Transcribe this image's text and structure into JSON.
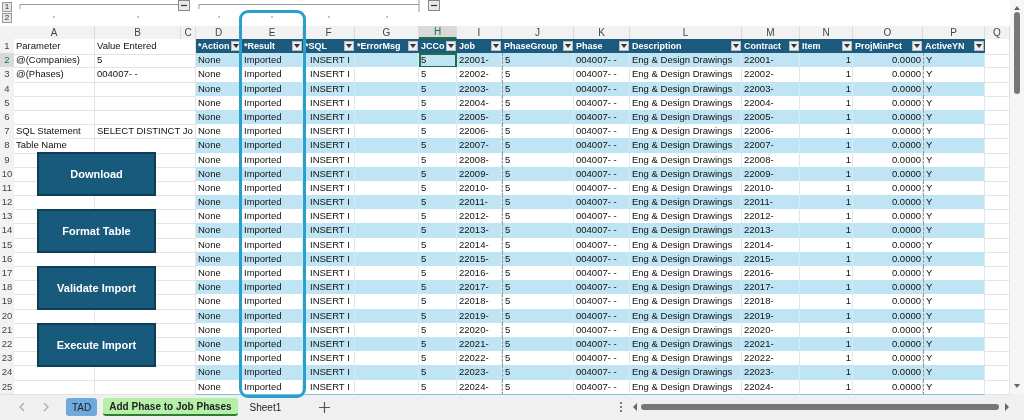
{
  "outline": {
    "levels": [
      "1",
      "2"
    ]
  },
  "columns": [
    {
      "letter": "A",
      "selected": false
    },
    {
      "letter": "B",
      "selected": false
    },
    {
      "letter": "C",
      "selected": false
    },
    {
      "letter": "D",
      "selected": false
    },
    {
      "letter": "E",
      "selected": false
    },
    {
      "letter": "F",
      "selected": false
    },
    {
      "letter": "G",
      "selected": false
    },
    {
      "letter": "H",
      "selected": true
    },
    {
      "letter": "I",
      "selected": false
    },
    {
      "letter": "J",
      "selected": false
    },
    {
      "letter": "K",
      "selected": false
    },
    {
      "letter": "L",
      "selected": false
    },
    {
      "letter": "M",
      "selected": false
    },
    {
      "letter": "N",
      "selected": false
    },
    {
      "letter": "O",
      "selected": false
    },
    {
      "letter": "P",
      "selected": false
    },
    {
      "letter": "Q",
      "selected": false
    }
  ],
  "sheet_rows": [
    {
      "number": "1",
      "selected": false,
      "A": "Parameter",
      "B": "Value Entered"
    },
    {
      "number": "2",
      "selected": true,
      "A": "@(Companies)",
      "B": "5"
    },
    {
      "number": "3",
      "selected": false,
      "A": "@(Phases)",
      "B": "004007-  -"
    },
    {
      "number": "4",
      "selected": false
    },
    {
      "number": "5",
      "selected": false
    },
    {
      "number": "6",
      "selected": false
    },
    {
      "number": "7",
      "selected": false,
      "A": "SQL Statement",
      "B": "SELECT DISTINCT Jo"
    },
    {
      "number": "8",
      "selected": false,
      "A": "Table Name"
    },
    {
      "number": "9",
      "selected": false
    },
    {
      "number": "10",
      "selected": false
    },
    {
      "number": "11",
      "selected": false
    },
    {
      "number": "12",
      "selected": false
    },
    {
      "number": "13",
      "selected": false
    },
    {
      "number": "14",
      "selected": false
    },
    {
      "number": "15",
      "selected": false
    },
    {
      "number": "16",
      "selected": false
    },
    {
      "number": "17",
      "selected": false
    },
    {
      "number": "18",
      "selected": false
    },
    {
      "number": "19",
      "selected": false
    },
    {
      "number": "20",
      "selected": false
    },
    {
      "number": "21",
      "selected": false
    },
    {
      "number": "22",
      "selected": false
    },
    {
      "number": "23",
      "selected": false
    },
    {
      "number": "24",
      "selected": false
    },
    {
      "number": "25",
      "selected": false
    }
  ],
  "table": {
    "headers": [
      {
        "label": "*Action"
      },
      {
        "label": "*Result"
      },
      {
        "label": "*SQL"
      },
      {
        "label": "*ErrorMsg"
      },
      {
        "label": "JCCo"
      },
      {
        "label": "Job"
      },
      {
        "label": "PhaseGroup"
      },
      {
        "label": "Phase"
      },
      {
        "label": "Description"
      },
      {
        "label": "Contract"
      },
      {
        "label": "Item"
      },
      {
        "label": "ProjMinPct"
      },
      {
        "label": "ActiveYN"
      }
    ],
    "rows": [
      {
        "D": "None",
        "E": "Imported",
        "F": "INSERT I",
        "H": "5",
        "I": "22001-",
        "J": "5",
        "K": "004007-  -",
        "L": "Eng & Design Drawings",
        "M": "22001-",
        "N": "1",
        "O": "0.0000",
        "P": "Y"
      },
      {
        "D": "None",
        "E": "Imported",
        "F": "INSERT I",
        "H": "5",
        "I": "22002-",
        "J": "5",
        "K": "004007-  -",
        "L": "Eng & Design Drawings",
        "M": "22002-",
        "N": "1",
        "O": "0.0000",
        "P": "Y"
      },
      {
        "D": "None",
        "E": "Imported",
        "F": "INSERT I",
        "H": "5",
        "I": "22003-",
        "J": "5",
        "K": "004007-  -",
        "L": "Eng & Design Drawings",
        "M": "22003-",
        "N": "1",
        "O": "0.0000",
        "P": "Y"
      },
      {
        "D": "None",
        "E": "Imported",
        "F": "INSERT I",
        "H": "5",
        "I": "22004-",
        "J": "5",
        "K": "004007-  -",
        "L": "Eng & Design Drawings",
        "M": "22004-",
        "N": "1",
        "O": "0.0000",
        "P": "Y"
      },
      {
        "D": "None",
        "E": "Imported",
        "F": "INSERT I",
        "H": "5",
        "I": "22005-",
        "J": "5",
        "K": "004007-  -",
        "L": "Eng & Design Drawings",
        "M": "22005-",
        "N": "1",
        "O": "0.0000",
        "P": "Y"
      },
      {
        "D": "None",
        "E": "Imported",
        "F": "INSERT I",
        "H": "5",
        "I": "22006-",
        "J": "5",
        "K": "004007-  -",
        "L": "Eng & Design Drawings",
        "M": "22006-",
        "N": "1",
        "O": "0.0000",
        "P": "Y"
      },
      {
        "D": "None",
        "E": "Imported",
        "F": "INSERT I",
        "H": "5",
        "I": "22007-",
        "J": "5",
        "K": "004007-  -",
        "L": "Eng & Design Drawings",
        "M": "22007-",
        "N": "1",
        "O": "0.0000",
        "P": "Y"
      },
      {
        "D": "None",
        "E": "Imported",
        "F": "INSERT I",
        "H": "5",
        "I": "22008-",
        "J": "5",
        "K": "004007-  -",
        "L": "Eng & Design Drawings",
        "M": "22008-",
        "N": "1",
        "O": "0.0000",
        "P": "Y"
      },
      {
        "D": "None",
        "E": "Imported",
        "F": "INSERT I",
        "H": "5",
        "I": "22009-",
        "J": "5",
        "K": "004007-  -",
        "L": "Eng & Design Drawings",
        "M": "22009-",
        "N": "1",
        "O": "0.0000",
        "P": "Y"
      },
      {
        "D": "None",
        "E": "Imported",
        "F": "INSERT I",
        "H": "5",
        "I": "22010-",
        "J": "5",
        "K": "004007-  -",
        "L": "Eng & Design Drawings",
        "M": "22010-",
        "N": "1",
        "O": "0.0000",
        "P": "Y"
      },
      {
        "D": "None",
        "E": "Imported",
        "F": "INSERT I",
        "H": "5",
        "I": "22011-",
        "J": "5",
        "K": "004007-  -",
        "L": "Eng & Design Drawings",
        "M": "22011-",
        "N": "1",
        "O": "0.0000",
        "P": "Y"
      },
      {
        "D": "None",
        "E": "Imported",
        "F": "INSERT I",
        "H": "5",
        "I": "22012-",
        "J": "5",
        "K": "004007-  -",
        "L": "Eng & Design Drawings",
        "M": "22012-",
        "N": "1",
        "O": "0.0000",
        "P": "Y"
      },
      {
        "D": "None",
        "E": "Imported",
        "F": "INSERT I",
        "H": "5",
        "I": "22013-",
        "J": "5",
        "K": "004007-  -",
        "L": "Eng & Design Drawings",
        "M": "22013-",
        "N": "1",
        "O": "0.0000",
        "P": "Y"
      },
      {
        "D": "None",
        "E": "Imported",
        "F": "INSERT I",
        "H": "5",
        "I": "22014-",
        "J": "5",
        "K": "004007-  -",
        "L": "Eng & Design Drawings",
        "M": "22014-",
        "N": "1",
        "O": "0.0000",
        "P": "Y"
      },
      {
        "D": "None",
        "E": "Imported",
        "F": "INSERT I",
        "H": "5",
        "I": "22015-",
        "J": "5",
        "K": "004007-  -",
        "L": "Eng & Design Drawings",
        "M": "22015-",
        "N": "1",
        "O": "0.0000",
        "P": "Y"
      },
      {
        "D": "None",
        "E": "Imported",
        "F": "INSERT I",
        "H": "5",
        "I": "22016-",
        "J": "5",
        "K": "004007-  -",
        "L": "Eng & Design Drawings",
        "M": "22016-",
        "N": "1",
        "O": "0.0000",
        "P": "Y"
      },
      {
        "D": "None",
        "E": "Imported",
        "F": "INSERT I",
        "H": "5",
        "I": "22017-",
        "J": "5",
        "K": "004007-  -",
        "L": "Eng & Design Drawings",
        "M": "22017-",
        "N": "1",
        "O": "0.0000",
        "P": "Y"
      },
      {
        "D": "None",
        "E": "Imported",
        "F": "INSERT I",
        "H": "5",
        "I": "22018-",
        "J": "5",
        "K": "004007-  -",
        "L": "Eng & Design Drawings",
        "M": "22018-",
        "N": "1",
        "O": "0.0000",
        "P": "Y"
      },
      {
        "D": "None",
        "E": "Imported",
        "F": "INSERT I",
        "H": "5",
        "I": "22019-",
        "J": "5",
        "K": "004007-  -",
        "L": "Eng & Design Drawings",
        "M": "22019-",
        "N": "1",
        "O": "0.0000",
        "P": "Y"
      },
      {
        "D": "None",
        "E": "Imported",
        "F": "INSERT I",
        "H": "5",
        "I": "22020-",
        "J": "5",
        "K": "004007-  -",
        "L": "Eng & Design Drawings",
        "M": "22020-",
        "N": "1",
        "O": "0.0000",
        "P": "Y"
      },
      {
        "D": "None",
        "E": "Imported",
        "F": "INSERT I",
        "H": "5",
        "I": "22021-",
        "J": "5",
        "K": "004007-  -",
        "L": "Eng & Design Drawings",
        "M": "22021-",
        "N": "1",
        "O": "0.0000",
        "P": "Y"
      },
      {
        "D": "None",
        "E": "Imported",
        "F": "INSERT I",
        "H": "5",
        "I": "22022-",
        "J": "5",
        "K": "004007-  -",
        "L": "Eng & Design Drawings",
        "M": "22022-",
        "N": "1",
        "O": "0.0000",
        "P": "Y"
      },
      {
        "D": "None",
        "E": "Imported",
        "F": "INSERT I",
        "H": "5",
        "I": "22023-",
        "J": "5",
        "K": "004007-  -",
        "L": "Eng & Design Drawings",
        "M": "22023-",
        "N": "1",
        "O": "0.0000",
        "P": "Y"
      },
      {
        "D": "None",
        "E": "Imported",
        "F": "INSERT I",
        "H": "5",
        "I": "22024-",
        "J": "5",
        "K": "004007-  -",
        "L": "Eng & Design Drawings",
        "M": "22024-",
        "N": "1",
        "O": "0.0000",
        "P": "Y"
      }
    ]
  },
  "macro_buttons": [
    "Download",
    "Format Table",
    "Validate Import",
    "Execute Import"
  ],
  "tabs": [
    {
      "label": "TAD",
      "selected": false,
      "color": "#6fa8dc"
    },
    {
      "label": "Add Phase to Job Phases",
      "selected": true,
      "color": "#b6f0a8"
    },
    {
      "label": "Sheet1",
      "selected": false
    }
  ]
}
